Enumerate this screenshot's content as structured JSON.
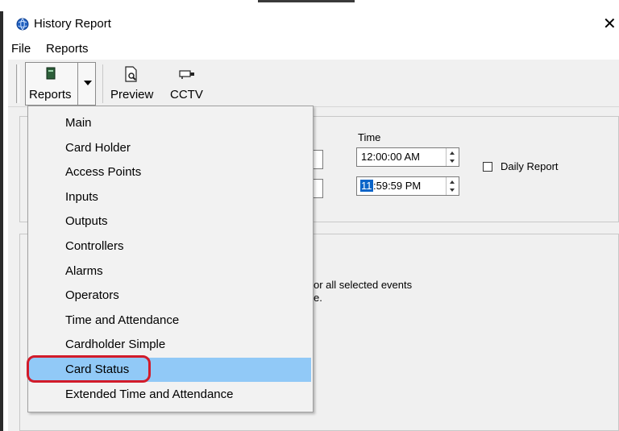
{
  "window": {
    "title": "History Report",
    "close_glyph": "✕"
  },
  "menubar": {
    "file": "File",
    "reports": "Reports"
  },
  "toolbar": {
    "reports_label": "Reports",
    "preview_label": "Preview",
    "cctv_label": "CCTV"
  },
  "filters": {
    "time_label": "Time",
    "start_time": {
      "rest": "12:00:00 AM"
    },
    "end_time": {
      "selected": "11",
      "rest": ":59:59 PM"
    },
    "daily_report_label": "Daily Report",
    "daily_report_checked": false
  },
  "info": {
    "line1": "or all selected events",
    "line2": "e."
  },
  "reports_menu": {
    "items": [
      "Main",
      "Card Holder",
      "Access Points",
      "Inputs",
      "Outputs",
      "Controllers",
      "Alarms",
      "Operators",
      "Time and Attendance",
      "Cardholder Simple",
      "Card Status",
      "Extended Time and Attendance"
    ],
    "highlighted": "Card Status"
  },
  "colors": {
    "menu_highlight": "#91c9f7",
    "annotation": "#d21b2a",
    "selection": "#0a64c8"
  }
}
